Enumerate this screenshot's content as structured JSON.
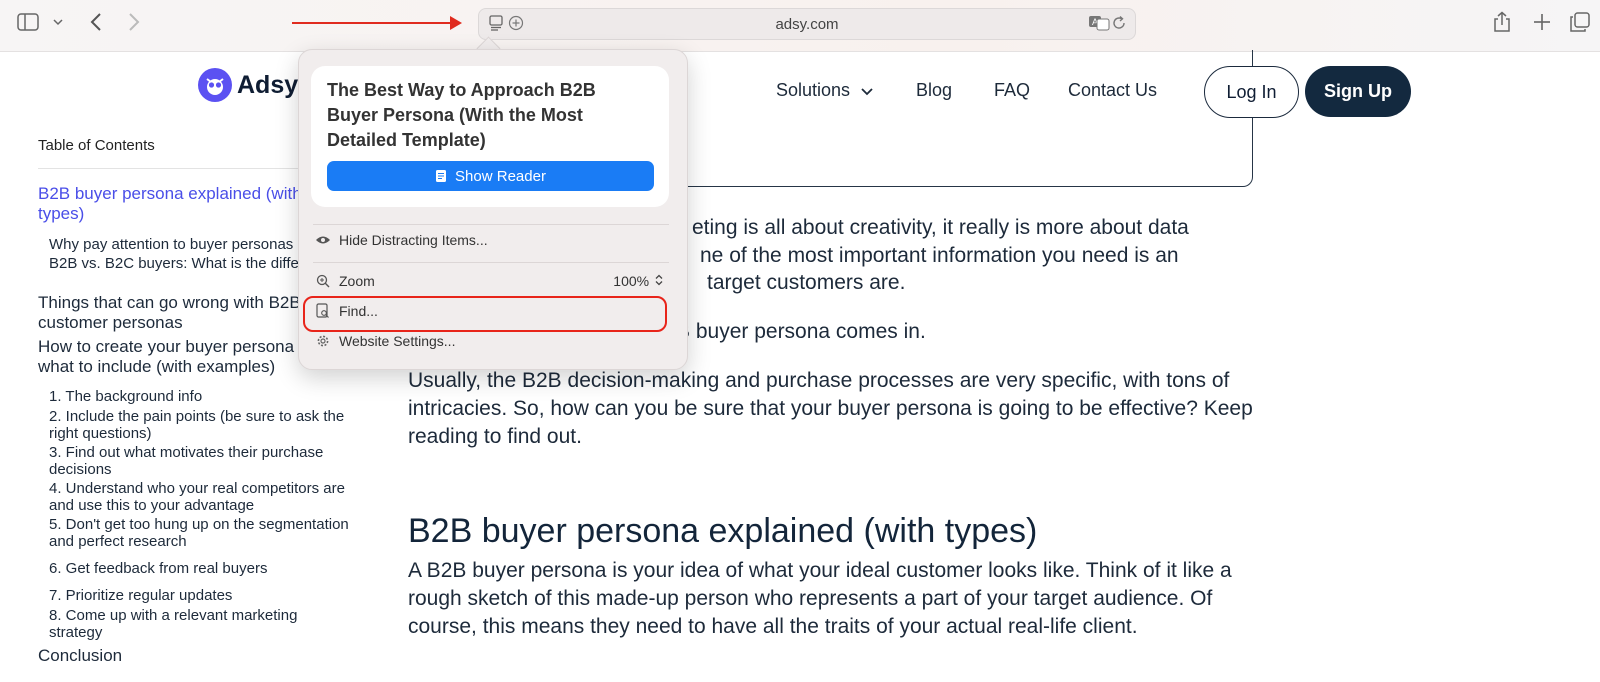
{
  "browser": {
    "url": "adsy.com",
    "icons": [
      "sidebar-icon",
      "chevron-down-icon",
      "back-icon",
      "forward-icon",
      "reader-icon",
      "add-icon",
      "translate-icon",
      "reload-icon",
      "share-icon",
      "new-tab-icon",
      "tabs-icon"
    ]
  },
  "site": {
    "logo_text": "Adsy",
    "nav": {
      "solutions": "Solutions",
      "blog": "Blog",
      "faq": "FAQ",
      "contact": "Contact Us"
    },
    "login": "Log In",
    "signup": "Sign Up"
  },
  "toc": {
    "title": "Table of Contents",
    "items": [
      "B2B buyer persona explained (with types)",
      "Why pay attention to buyer personas",
      "B2B vs. B2C buyers: What is the difference?",
      "Things that can go wrong with B2B customer personas",
      "How to create your buyer persona and what to include (with examples)",
      "1. The background info",
      "2. Include the pain points (be sure to ask the right questions)",
      "3. Find out what motivates their purchase decisions",
      "4. Understand who your real competitors are and use this to your advantage",
      "5. Don't get too hung up on the segmentation and perfect research",
      "6. Get feedback from real buyers",
      "7. Prioritize regular updates",
      "8. Come up with a relevant marketing strategy",
      "Conclusion"
    ]
  },
  "article": {
    "p1_line1": "eting is all about creativity, it really is more about data",
    "p1_line2": "ne of the most important information you need is an",
    "p1_line3": "target customers are.",
    "p2": "B buyer persona comes in.",
    "p3": "Usually, the B2B decision-making and purchase processes are very specific, with tons of intricacies. So, how can you be sure that your buyer persona is going to be effective? Keep reading to find out.",
    "heading": "B2B buyer persona explained (with types)",
    "p4": "A B2B buyer persona is your idea of what your ideal customer looks like. Think of it like a rough sketch of this made-up person who represents a part of your target audience. Of course, this means they need to have all the traits of your actual real-life client."
  },
  "popover": {
    "reader_title": "The Best Way to Approach B2B Buyer Persona (With the Most Detailed Template)",
    "show_reader": "Show Reader",
    "hide_distracting": "Hide Distracting Items...",
    "zoom_label": "Zoom",
    "zoom_value": "100%",
    "find": "Find...",
    "website_settings": "Website Settings..."
  },
  "colors": {
    "accent_blue": "#1a7cf5",
    "highlight_red": "#e8241a",
    "brand_purple": "#5b51f2",
    "toc_active": "#4a4ee8"
  }
}
